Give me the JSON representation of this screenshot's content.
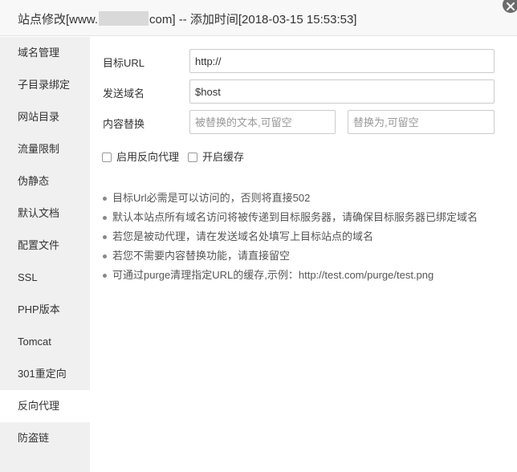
{
  "dialog": {
    "title_prefix": "站点修改[www.",
    "title_suffix": "com] -- 添加时间[2018-03-15 15:53:53]"
  },
  "sidebar": {
    "items": [
      {
        "label": "域名管理"
      },
      {
        "label": "子目录绑定"
      },
      {
        "label": "网站目录"
      },
      {
        "label": "流量限制"
      },
      {
        "label": "伪静态"
      },
      {
        "label": "默认文档"
      },
      {
        "label": "配置文件"
      },
      {
        "label": "SSL"
      },
      {
        "label": "PHP版本"
      },
      {
        "label": "Tomcat"
      },
      {
        "label": "301重定向"
      },
      {
        "label": "反向代理",
        "active": true
      },
      {
        "label": "防盗链"
      }
    ]
  },
  "form": {
    "target_url": {
      "label": "目标URL",
      "value": "http://"
    },
    "send_domain": {
      "label": "发送域名",
      "value": "$host"
    },
    "replace": {
      "label": "内容替换",
      "from_placeholder": "被替换的文本,可留空",
      "to_placeholder": "替换为,可留空"
    },
    "enable_proxy": {
      "label": "启用反向代理",
      "checked": false
    },
    "enable_cache": {
      "label": "开启缓存",
      "checked": false
    }
  },
  "tips": [
    "目标Url必需是可以访问的，否则将直接502",
    "默认本站点所有域名访问将被传递到目标服务器，请确保目标服务器已绑定域名",
    "若您是被动代理，请在发送域名处填写上目标站点的域名",
    "若您不需要内容替换功能，请直接留空",
    "可通过purge清理指定URL的缓存,示例：http://test.com/purge/test.png"
  ]
}
